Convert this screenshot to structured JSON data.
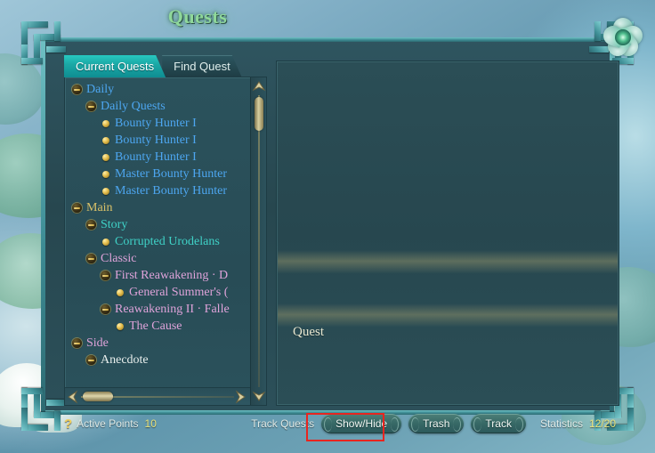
{
  "window": {
    "title": "Quests",
    "close_icon": "blossom-close-icon"
  },
  "tabs": [
    {
      "label": "Current Quests",
      "active": true
    },
    {
      "label": "Find Quest",
      "active": false
    }
  ],
  "quest_tree": [
    {
      "label": "Daily",
      "depth": 0,
      "type": "branch",
      "color": "c-blue"
    },
    {
      "label": "Daily Quests",
      "depth": 1,
      "type": "branch",
      "color": "c-blue"
    },
    {
      "label": "Bounty Hunter I",
      "depth": 2,
      "type": "leaf",
      "color": "c-blue"
    },
    {
      "label": "Bounty Hunter I",
      "depth": 2,
      "type": "leaf",
      "color": "c-blue"
    },
    {
      "label": "Bounty Hunter I",
      "depth": 2,
      "type": "leaf",
      "color": "c-blue"
    },
    {
      "label": "Master Bounty Hunter",
      "depth": 2,
      "type": "leaf",
      "color": "c-blue"
    },
    {
      "label": "Master Bounty Hunter",
      "depth": 2,
      "type": "leaf",
      "color": "c-blue"
    },
    {
      "label": "Main",
      "depth": 0,
      "type": "branch",
      "color": "c-gold"
    },
    {
      "label": "Story",
      "depth": 1,
      "type": "branch",
      "color": "c-cyan"
    },
    {
      "label": "Corrupted Urodelans",
      "depth": 2,
      "type": "leaf",
      "color": "c-cyan"
    },
    {
      "label": "Classic",
      "depth": 1,
      "type": "branch",
      "color": "c-pink"
    },
    {
      "label": "First Reawakening · D",
      "depth": 2,
      "type": "branch",
      "color": "c-pink"
    },
    {
      "label": "General Summer's (",
      "depth": 3,
      "type": "leaf",
      "color": "c-pink"
    },
    {
      "label": "Reawakening II · Falle",
      "depth": 2,
      "type": "branch",
      "color": "c-pink"
    },
    {
      "label": "The Cause",
      "depth": 3,
      "type": "leaf",
      "color": "c-pink"
    },
    {
      "label": "Side",
      "depth": 0,
      "type": "branch",
      "color": "c-pink"
    },
    {
      "label": "Anecdote",
      "depth": 1,
      "type": "branch",
      "color": "c-white"
    }
  ],
  "detail": {
    "text": "Quest"
  },
  "bottom_bar": {
    "help_icon": "?",
    "active_points_label": "Active Points",
    "active_points_value": "10",
    "track_quests_label": "Track Quests",
    "buttons": [
      {
        "label": "Show/Hide",
        "highlighted": true
      },
      {
        "label": "Trash",
        "highlighted": false
      },
      {
        "label": "Track",
        "highlighted": false
      }
    ],
    "statistics_label": "Statistics",
    "statistics_value": "12/20"
  },
  "colors": {
    "highlight_box": "#e8251f",
    "tab_active": "#1ba9a6",
    "accent_gold": "#e8e27a",
    "quest_blue": "#4da6f0",
    "quest_cyan": "#3fd2c7",
    "quest_pink": "#dfa3da"
  }
}
